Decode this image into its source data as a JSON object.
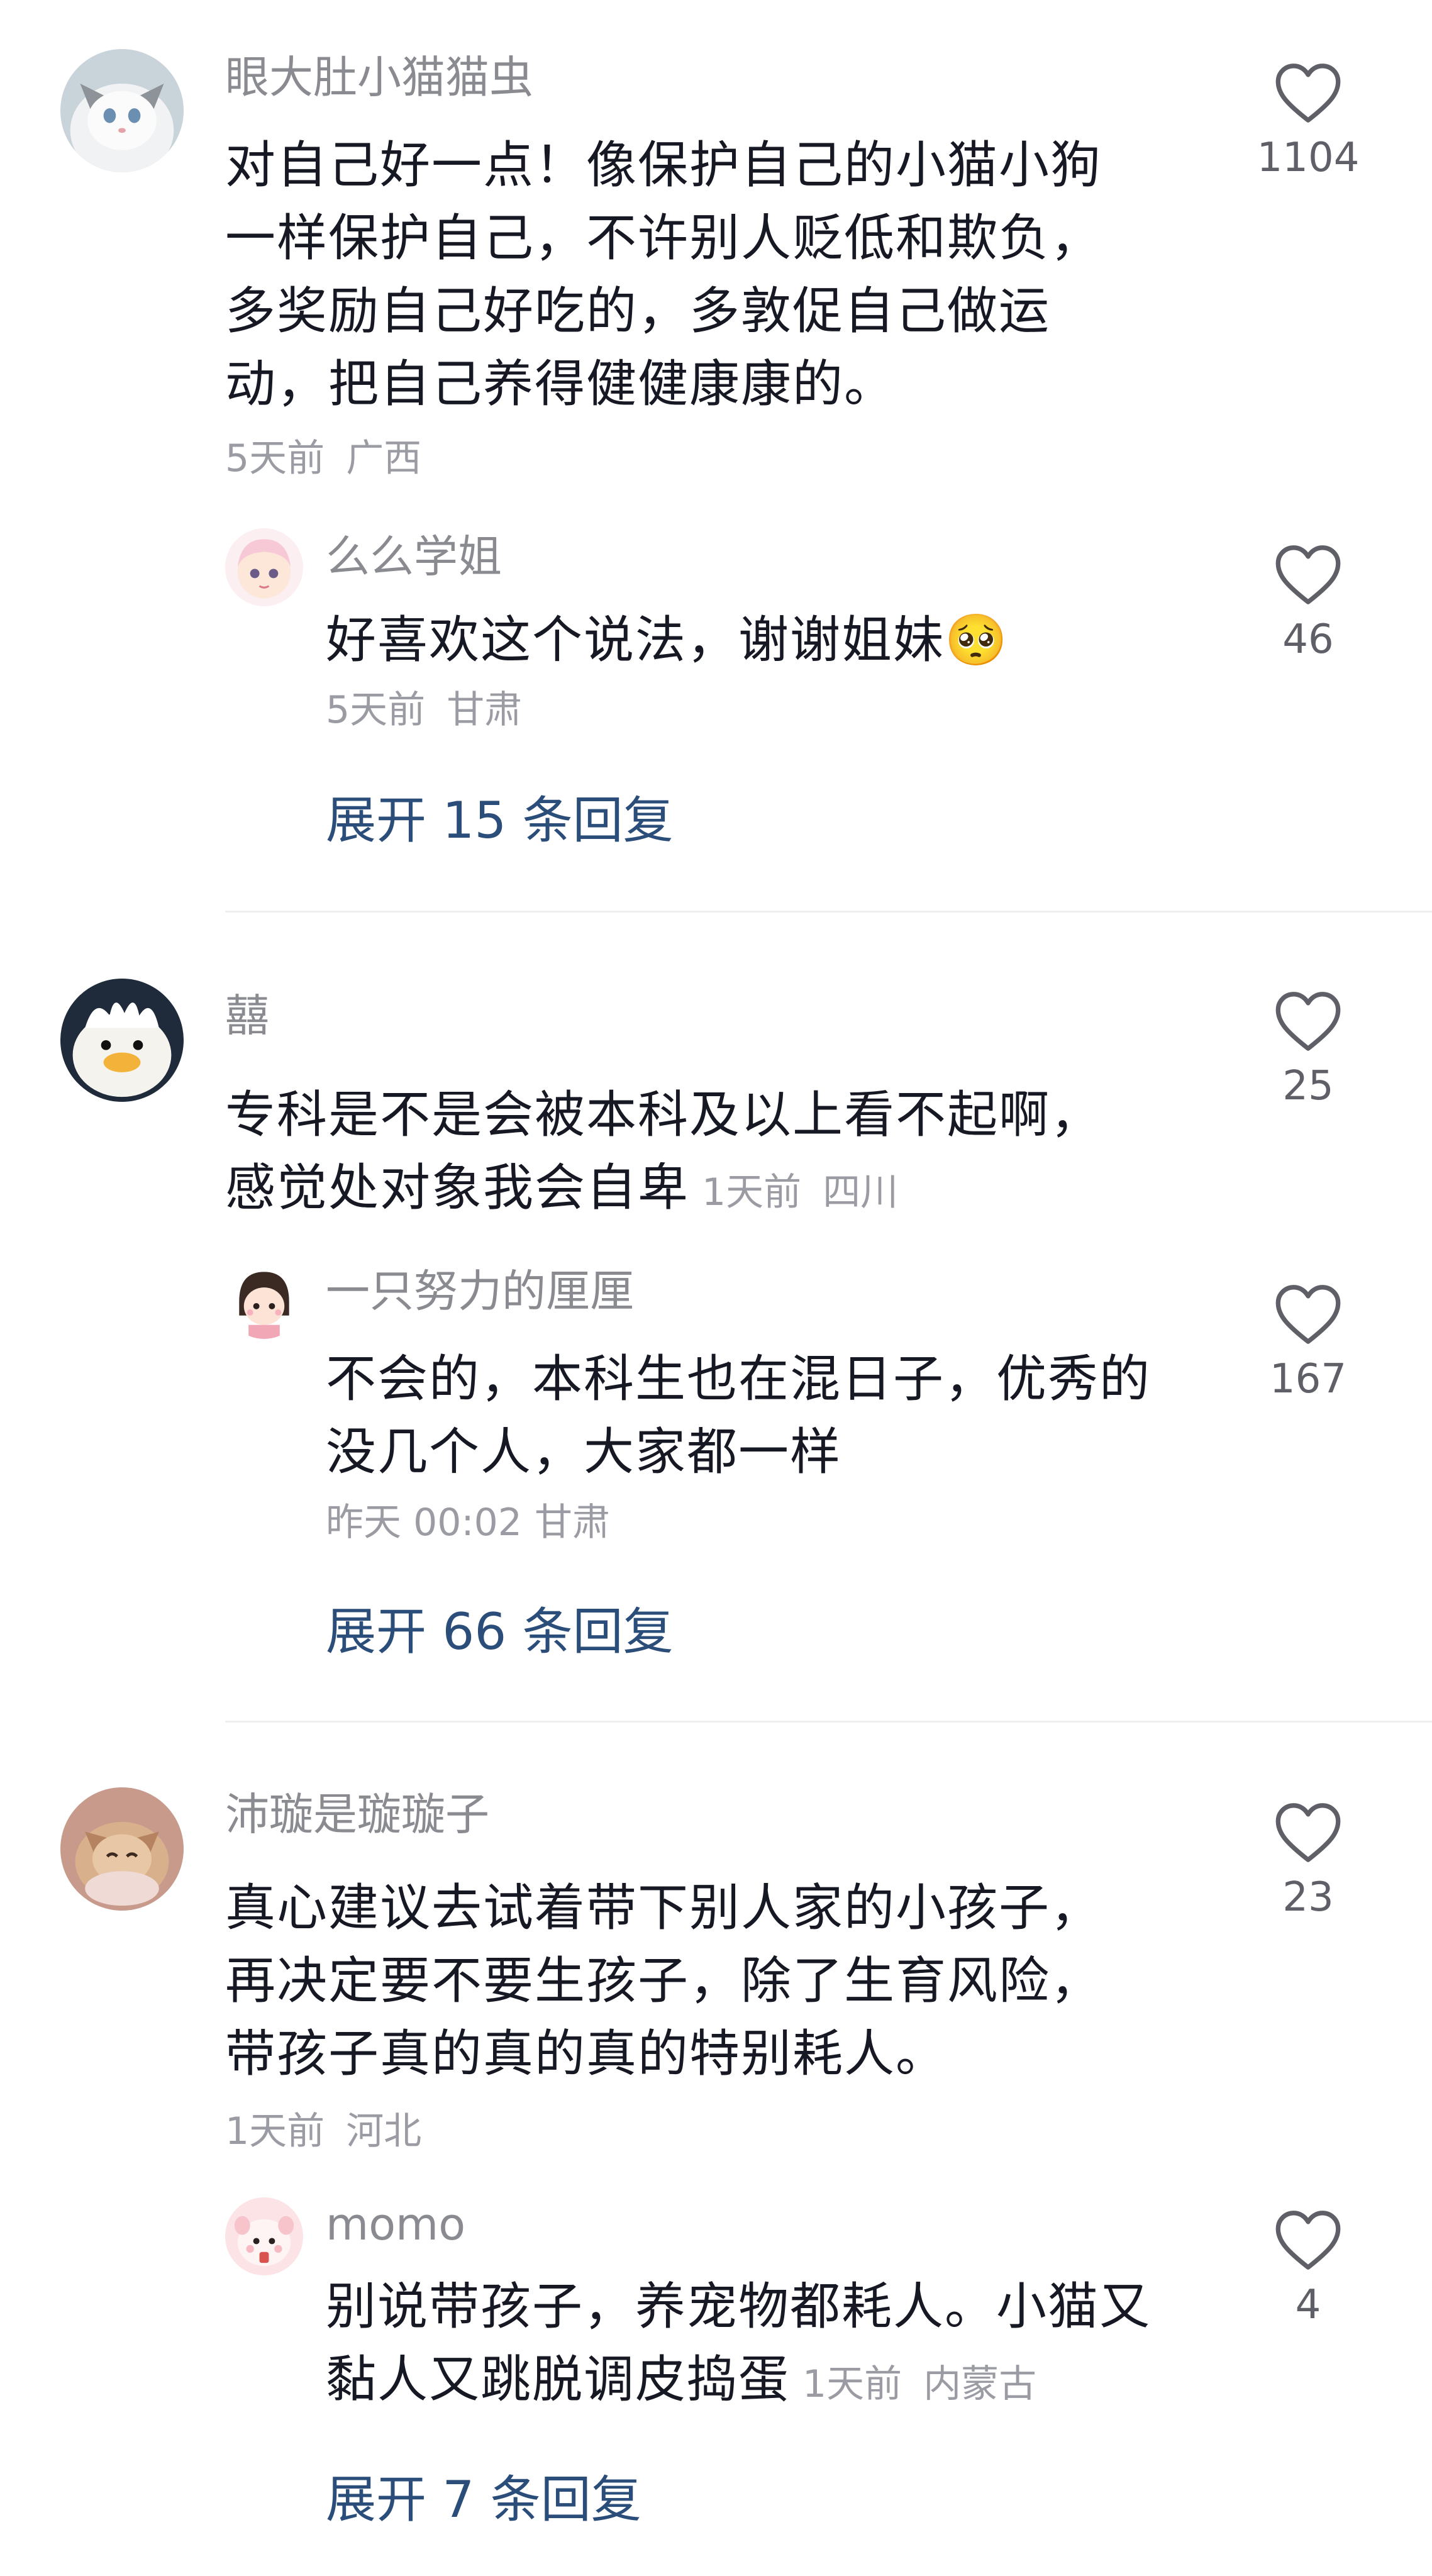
{
  "comments": [
    {
      "author": "眼大肚小猫猫虫",
      "lines": [
        "对自己好一点！像保护自己的小猫小狗",
        "一样保护自己，不许别人贬低和欺负，",
        "多奖励自己好吃的，多敦促自己做运",
        "动，把自己养得健健康康的。"
      ],
      "time": "5天前",
      "location": "广西",
      "likes": "1104",
      "reply": {
        "author": "么么学姐",
        "text": "好喜欢这个说法，谢谢姐妹🥺",
        "time": "5天前",
        "location": "甘肃",
        "likes": "46"
      },
      "expand_label": "展开 15 条回复"
    },
    {
      "author": "囍",
      "lines": [
        "专科是不是会被本科及以上看不起啊，",
        "感觉处对象我会自卑"
      ],
      "time": "1天前",
      "location": "四川",
      "likes": "25",
      "reply": {
        "author": "一只努力的厘厘",
        "lines": [
          "不会的，本科生也在混日子，优秀的",
          "没几个人，大家都一样"
        ],
        "time": "昨天 00:02",
        "location": "甘肃",
        "likes": "167"
      },
      "expand_label": "展开 66 条回复"
    },
    {
      "author": "沛璇是璇璇子",
      "lines": [
        "真心建议去试着带下别人家的小孩子，",
        "再决定要不要生孩子，除了生育风险，",
        "带孩子真的真的真的特别耗人。"
      ],
      "time": "1天前",
      "location": "河北",
      "likes": "23",
      "reply": {
        "author": "momo",
        "lines": [
          "别说带孩子，养宠物都耗人。小猫又",
          "黏人又跳脱调皮捣蛋"
        ],
        "time": "1天前",
        "location": "内蒙古",
        "likes": "4"
      },
      "expand_label": "展开 7 条回复"
    }
  ],
  "icons": {
    "like": "heart-outline-icon"
  },
  "colors": {
    "text": "#161823",
    "secondary": "#8a8b91",
    "link": "#2b4d7a",
    "divider": "#eeeeef"
  }
}
